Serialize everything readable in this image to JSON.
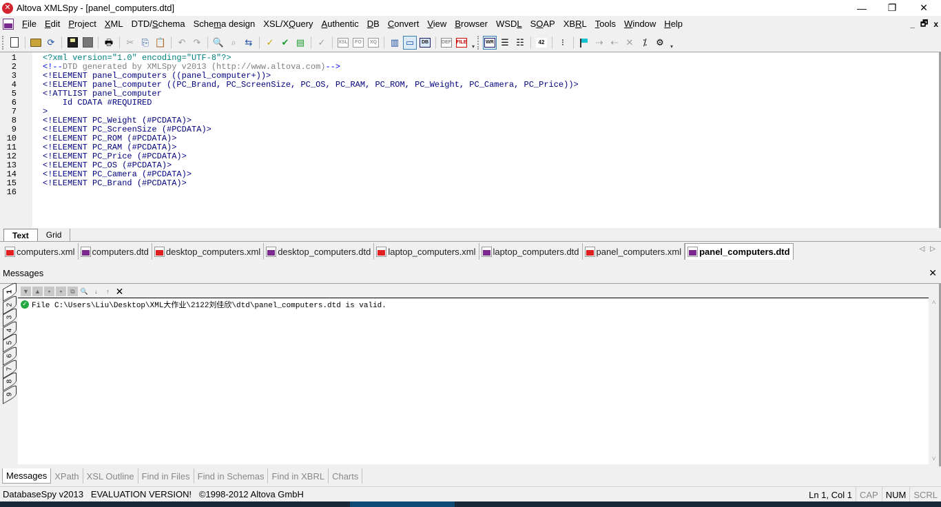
{
  "window": {
    "title": "Altova XMLSpy - [panel_computers.dtd]",
    "app_icon": "altova-logo-icon",
    "controls": {
      "minimize": "—",
      "restore": "❐",
      "close": "✕"
    },
    "mdi_controls": {
      "minimize": "_",
      "restore": "🗗",
      "close": "x"
    }
  },
  "menu": {
    "doc_icon": "dtd-document-icon",
    "items": [
      {
        "label": "File",
        "accel": "F"
      },
      {
        "label": "Edit",
        "accel": "E"
      },
      {
        "label": "Project",
        "accel": "P"
      },
      {
        "label": "XML",
        "accel": "X"
      },
      {
        "label": "DTD/Schema",
        "accel": "S"
      },
      {
        "label": "Schema design",
        "accel": "m"
      },
      {
        "label": "XSL/XQuery",
        "accel": "Q"
      },
      {
        "label": "Authentic",
        "accel": "A"
      },
      {
        "label": "DB",
        "accel": "D"
      },
      {
        "label": "Convert",
        "accel": "C"
      },
      {
        "label": "View",
        "accel": "V"
      },
      {
        "label": "Browser",
        "accel": "B"
      },
      {
        "label": "WSDL",
        "accel": "L"
      },
      {
        "label": "SOAP",
        "accel": "O"
      },
      {
        "label": "XBRL",
        "accel": "R"
      },
      {
        "label": "Tools",
        "accel": "T"
      },
      {
        "label": "Window",
        "accel": "W"
      },
      {
        "label": "Help",
        "accel": "H"
      }
    ]
  },
  "toolbar": {
    "glyphs": {
      "print": "🖶",
      "cut": "✂",
      "copy": "⎘",
      "paste": "📋",
      "undo": "↶",
      "redo": "↷",
      "find": "🔍",
      "find_next": "⌕",
      "replace": "⇆",
      "check_wf": "✓",
      "validate": "✔",
      "generate_dtd": "▤",
      "spellcheck": "✓",
      "xsl": "XSL",
      "fo": "FO",
      "xq": "XQ",
      "layout1": "▥",
      "layout2": "▭",
      "db": "DB",
      "def": "DEF",
      "file": "FILE",
      "wrap": "WR",
      "indent": "☰",
      "outdent": "☷",
      "linenum": "42",
      "bookmark": "⁝",
      "bm_next": "⇢",
      "bm_prev": "⇠",
      "bm_clear": "✕",
      "fold": "⁒",
      "options": "⚙",
      "more": "▾"
    }
  },
  "editor": {
    "line_numbers": [
      "1",
      "2",
      "3",
      "4",
      "5",
      "6",
      "7",
      "8",
      "9",
      "10",
      "11",
      "12",
      "13",
      "14",
      "15",
      "16"
    ],
    "lines": {
      "l1": "<?xml version=\"1.0\" encoding=\"UTF-8\"?>",
      "l2_open": "<!--",
      "l2_body": "DTD generated by XMLSpy v2013 (http://www.altova.com)",
      "l2_close": "-->",
      "l3": "<!ELEMENT panel_computers ((panel_computer+))>",
      "l4": "<!ELEMENT panel_computer ((PC_Brand, PC_ScreenSize, PC_OS, PC_RAM, PC_ROM, PC_Weight, PC_Camera, PC_Price))>",
      "l5": "<!ATTLIST panel_computer",
      "l6": "    Id CDATA #REQUIRED",
      "l7": ">",
      "l8": "<!ELEMENT PC_Weight (#PCDATA)>",
      "l9": "<!ELEMENT PC_ScreenSize (#PCDATA)>",
      "l10": "<!ELEMENT PC_ROM (#PCDATA)>",
      "l11": "<!ELEMENT PC_RAM (#PCDATA)>",
      "l12": "<!ELEMENT PC_Price (#PCDATA)>",
      "l13": "<!ELEMENT PC_OS (#PCDATA)>",
      "l14": "<!ELEMENT PC_Camera (#PCDATA)>",
      "l15": "<!ELEMENT PC_Brand (#PCDATA)>",
      "l16": ""
    }
  },
  "view_tabs": [
    {
      "label": "Text",
      "active": true
    },
    {
      "label": "Grid",
      "active": false
    }
  ],
  "file_tabs": [
    {
      "label": "computers.xml",
      "type": "xml"
    },
    {
      "label": "computers.dtd",
      "type": "dtd"
    },
    {
      "label": "desktop_computers.xml",
      "type": "xml"
    },
    {
      "label": "desktop_computers.dtd",
      "type": "dtd"
    },
    {
      "label": "laptop_computers.xml",
      "type": "xml"
    },
    {
      "label": "laptop_computers.dtd",
      "type": "dtd"
    },
    {
      "label": "panel_computers.xml",
      "type": "xml"
    },
    {
      "label": "panel_computers.dtd",
      "type": "dtd",
      "active": true
    }
  ],
  "file_tab_nav": {
    "prev": "◁",
    "next": "▷"
  },
  "messages": {
    "title": "Messages",
    "close": "✕",
    "side_tabs": [
      "1",
      "2",
      "3",
      "4",
      "5",
      "6",
      "7",
      "8",
      "9"
    ],
    "toolbar": {
      "next": "▼",
      "prev": "▲",
      "copy": "▪",
      "copy_all": "▪",
      "clear_sel": "⧉",
      "find": "🔍",
      "find_next": "↓",
      "find_prev": "↑",
      "clear": "✕"
    },
    "status_icon": "✓",
    "text": "File C:\\Users\\Liu\\Desktop\\XML大作业\\2122刘佳欣\\dtd\\panel_computers.dtd is valid.",
    "scroll_up": "˄",
    "scroll_down": "˅"
  },
  "output_tabs": [
    {
      "label": "Messages",
      "active": true
    },
    {
      "label": "XPath"
    },
    {
      "label": "XSL Outline"
    },
    {
      "label": "Find in Files"
    },
    {
      "label": "Find in Schemas"
    },
    {
      "label": "Find in XBRL"
    },
    {
      "label": "Charts"
    }
  ],
  "statusbar": {
    "left": "DatabaseSpy v2013   EVALUATION VERSION!   ©1998-2012 Altova GmbH",
    "position": "Ln 1, Col 1",
    "cap": "CAP",
    "num": "NUM",
    "scrl": "SCRL"
  }
}
